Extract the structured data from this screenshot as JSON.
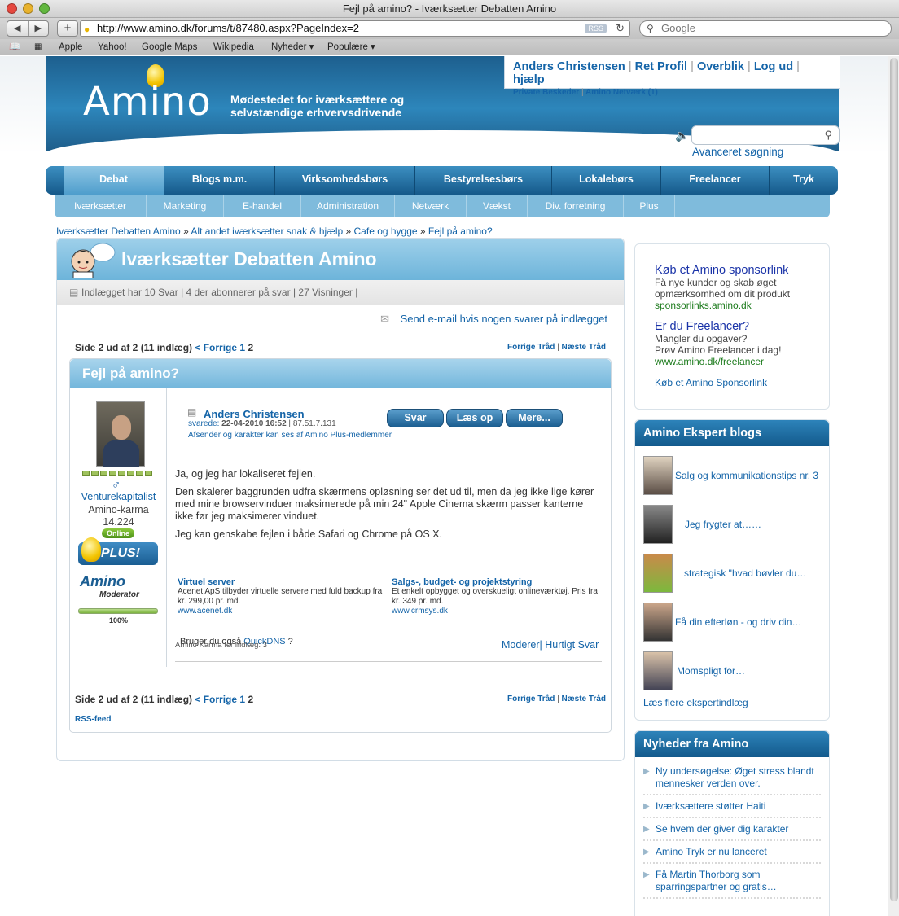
{
  "window": {
    "title": "Fejl på amino? - Iværksætter Debatten Amino"
  },
  "browser": {
    "url": "http://www.amino.dk/forums/t/87480.aspx?PageIndex=2",
    "rss_label": "RSS",
    "search_placeholder": "Google",
    "bookmarks": [
      "Apple",
      "Yahoo!",
      "Google Maps",
      "Wikipedia",
      "Nyheder ▾",
      "Populære ▾"
    ]
  },
  "site": {
    "logo": "Amino",
    "tagline_1": "Mødestedet for iværksættere og",
    "tagline_2": "selvstændige erhvervsdrivende",
    "user": {
      "name": "Anders Christensen",
      "links": [
        "Ret Profil",
        "Overblik",
        "Log ud",
        "hjælp"
      ],
      "sub_links": [
        "Private Beskeder",
        "Amino Netværk (1)"
      ]
    },
    "advanced_search": "Avanceret søgning"
  },
  "nav": {
    "main": [
      "Debat",
      "Blogs m.m.",
      "Virksomhedsbørs",
      "Bestyrelsesbørs",
      "Lokalebørs",
      "Freelancer",
      "Tryk"
    ],
    "active": "Debat",
    "sub": [
      "Iværksætter",
      "Marketing",
      "E-handel",
      "Administration",
      "Netværk",
      "Vækst",
      "Div. forretning",
      "Plus"
    ]
  },
  "breadcrumb": [
    "Iværksætter Debatten Amino",
    "Alt andet iværksætter snak & hjælp",
    "Cafe og hygge",
    "Fejl på amino?"
  ],
  "forum": {
    "title": "Iværksætter Debatten Amino",
    "info": "Indlægget har 10 Svar | 4 der abonnerer på svar | 27 Visninger |",
    "email_notify": "Send e-mail hvis nogen svarer på indlægget",
    "pager_text": "Side 2 ud af 2 (11 indlæg)",
    "pager_prev": "< Forrige",
    "pager_page1": "1",
    "pager_page2": "2",
    "prev_thread": "Forrige Tråd",
    "next_thread": "Næste Tråd",
    "rss_feed": "RSS-feed"
  },
  "post": {
    "title": "Fejl på amino?",
    "author": "Anders Christensen",
    "replied_label": "svarede:",
    "date": "22-04-2010 16:52",
    "ip": "87.51.7.131",
    "note": "Afsender og karakter kan ses af Amino Plus-medlemmer",
    "buttons": [
      "Svar",
      "Læs op",
      "Mere..."
    ],
    "body": [
      "Ja, og jeg har lokaliseret fejlen.",
      "Den skalerer baggrunden udfra skærmens opløsning ser det ud til, men da jeg ikke lige kører med mine browservinduer maksimerede på min 24\" Apple Cinema skærm passer kanterne ikke før jeg maksimerer vinduet.",
      "Jeg kan genskabe fejlen i både Safari og Chrome på OS X."
    ],
    "ads": [
      {
        "title": "Virtuel server",
        "text": "Acenet ApS tilbyder virtuelle servere med fuld backup fra kr. 299,00 pr. md.",
        "url": "www.acenet.dk"
      },
      {
        "title": "Salgs-, budget- og projektstyring",
        "text": "Et enkelt opbygget og overskueligt onlineværktøj. Pris fra kr. 349 pr. md.",
        "url": "www.crmsys.dk"
      }
    ],
    "quickdns_text": "Bruger du også",
    "quickdns_link": "QuickDNS",
    "quickdns_tail": " ?",
    "karma_text": "Amino Karma for indlæg: 3",
    "moderate": "Moderer",
    "quick_reply": "Hurtigt Svar",
    "author_rank": "Venturekapitalist",
    "karma_label": "Amino-karma",
    "karma_value": "14.224",
    "online": "Online",
    "plus_badge": "PLUS!",
    "mod_badge_logo": "Amino",
    "mod_badge_text": "Moderator",
    "mod_pct": "100%",
    "karma_level": 8
  },
  "sponsor": {
    "heading_1": "Køb et Amino sponsorlink",
    "desc_1a": "Få nye kunder og skab øget",
    "desc_1b": "opmærksomhed om dit produkt",
    "url_1": "sponsorlinks.amino.dk",
    "heading_2": "Er du Freelancer?",
    "desc_2a": "Mangler du opgaver?",
    "desc_2b": "Prøv Amino Freelancer i dag!",
    "url_2": "www.amino.dk/freelancer",
    "link": "Køb et Amino Sponsorlink"
  },
  "expert_blogs": {
    "title": "Amino Ekspert blogs",
    "items": [
      "Salg og kommunikationstips nr. 3",
      "Jeg frygter at……",
      "strategisk \"hvad bøvler du…",
      "Få din efterløn - og driv din…",
      "Momspligt for…"
    ],
    "more": "Læs flere ekspertindlæg"
  },
  "news": {
    "title": "Nyheder fra Amino",
    "items": [
      "Ny undersøgelse: Øget stress blandt mennesker verden over.",
      "Iværksættere støtter Haiti",
      "Se hvem der giver dig karakter",
      "Amino Tryk er nu lanceret",
      "Få Martin Thorborg som sparringspartner og gratis…"
    ]
  },
  "colors": {
    "brand_blue": "#1464a8",
    "header_blue": "#2d86bb",
    "light_blue": "#7fbbdc",
    "sponsor_url_green": "#1b7a1b"
  }
}
